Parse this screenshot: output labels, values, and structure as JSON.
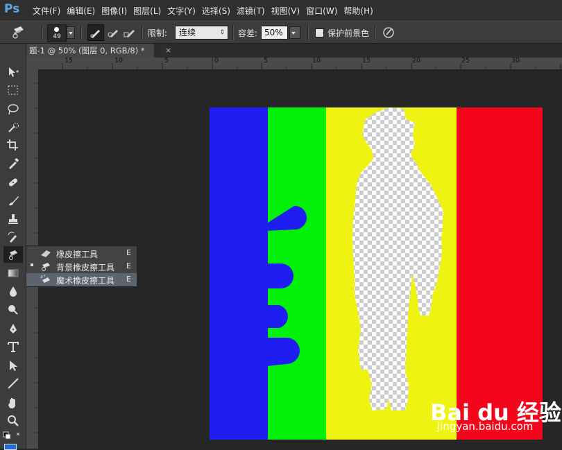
{
  "app": {
    "logo": "Ps"
  },
  "menu": [
    "文件(F)",
    "编辑(E)",
    "图像(I)",
    "图层(L)",
    "文字(Y)",
    "选择(S)",
    "滤镜(T)",
    "视图(V)",
    "窗口(W)",
    "帮助(H)"
  ],
  "options": {
    "brush_size": "49",
    "limit_label": "限制:",
    "limit_value": "连续",
    "tolerance_label": "容差:",
    "tolerance_value": "50%",
    "protect_fg_label": "保护前景色"
  },
  "document": {
    "tab_title": "题-1 @ 50% (图层 0, RGB/8) *",
    "close": "×"
  },
  "ruler": {
    "h_labels": [
      "15",
      "10",
      "5",
      "0",
      "5",
      "10",
      "15",
      "20",
      "25",
      "30"
    ]
  },
  "tools": [
    "move-icon",
    "marquee-icon",
    "lasso-icon",
    "quick-select-icon",
    "crop-icon",
    "eyedropper-icon",
    "healing-icon",
    "brush-icon",
    "stamp-icon",
    "history-brush-icon",
    "eraser-icon",
    "gradient-icon",
    "blur-icon",
    "dodge-icon",
    "pen-icon",
    "type-icon",
    "path-select-icon",
    "line-icon",
    "hand-icon",
    "zoom-icon"
  ],
  "flyout": {
    "items": [
      {
        "label": "橡皮擦工具",
        "key": "E"
      },
      {
        "label": "背景橡皮擦工具",
        "key": "E"
      },
      {
        "label": "魔术橡皮擦工具",
        "key": "E"
      }
    ]
  },
  "watermark": {
    "line1": "Bai du 经验",
    "line2": "jingyan.baidu.com"
  },
  "colors": {
    "blue": "#1e1ef2",
    "green": "#03f008",
    "yellow": "#eef312",
    "red": "#f3061c",
    "menubar": "#2f2f2f",
    "optionsbar": "#3c3c3c",
    "workspace": "#262626"
  }
}
